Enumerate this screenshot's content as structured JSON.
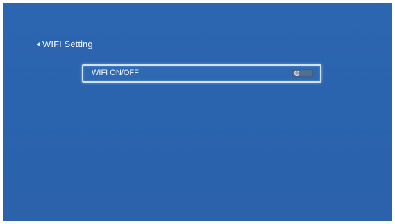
{
  "header": {
    "back_icon": "chevron-left-icon",
    "title": "WIFI Setting"
  },
  "settings": {
    "wifi_toggle": {
      "label": "WIFI ON/OFF",
      "state": "off"
    }
  },
  "colors": {
    "background": "#2a63ae",
    "focus_border": "#cfe3f7",
    "toggle_track": "#4f6f93"
  }
}
